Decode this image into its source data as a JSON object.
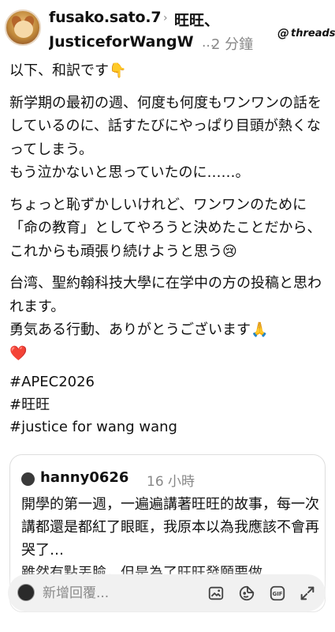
{
  "header": {
    "username": "fusako.sato.7",
    "reply_target_line1": "旺旺、",
    "reply_target_line2": "JusticeforWangW",
    "ellipsis": "...",
    "timestamp": "2 分鐘",
    "brand": "threads",
    "brand_glyph": "@"
  },
  "post": {
    "paragraphs": [
      "以下、和訳です👇",
      "新学期の最初の週、何度も何度もワンワンの話をしているのに、話すたびにやっぱり目頭が熱くなってしまう。\nもう泣かないと思っていたのに……。",
      "ちょっと恥ずかしいけれど、ワンワンのために「命の教育」としてやろうと決めたことだから、これからも頑張り続けようと思う😢",
      "台湾、聖約翰科技大學に在学中の方の投稿と思われます。\n勇気ある行動、ありがとうございます🙏\n❤️"
    ],
    "hashtags": [
      "#APEC2026",
      "#旺旺",
      "#justice for wang wang"
    ]
  },
  "quote": {
    "username": "hanny0626",
    "timestamp": "16 小時",
    "body": "開學的第一週，一遍遍講著旺旺的故事，每一次講都還是都紅了眼眶，我原本以為我應該不會再哭了…\n雖然有點丟臉，但是為了旺旺發願要做"
  },
  "composer": {
    "placeholder": "新增回覆...",
    "icons": [
      "image-icon",
      "sticker-icon",
      "gif-icon",
      "expand-icon"
    ],
    "gif_label": "GIF"
  }
}
